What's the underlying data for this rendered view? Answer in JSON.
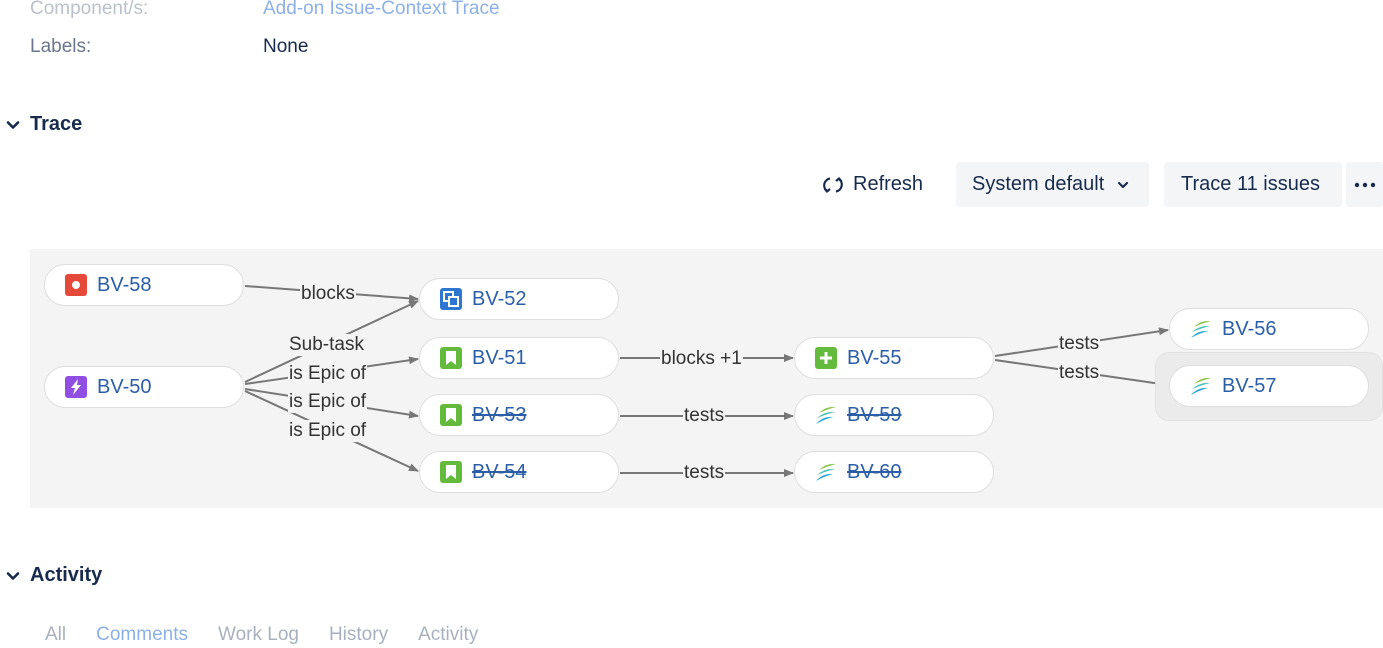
{
  "fields": {
    "component_label": "Component/s:",
    "component_value": "Add-on Issue-Context Trace",
    "labels_label": "Labels:",
    "labels_value": "None"
  },
  "trace": {
    "title": "Trace",
    "refresh_label": "Refresh",
    "layout_select": "System default",
    "trace_button": "Trace 11 issues",
    "more_icon": "ellipsis-icon",
    "nodes": [
      {
        "key": "BV-58",
        "type": "bug",
        "done": false
      },
      {
        "key": "BV-50",
        "type": "epic",
        "done": false
      },
      {
        "key": "BV-52",
        "type": "subtask",
        "done": false
      },
      {
        "key": "BV-51",
        "type": "story",
        "done": false
      },
      {
        "key": "BV-53",
        "type": "story",
        "done": true
      },
      {
        "key": "BV-54",
        "type": "story",
        "done": true
      },
      {
        "key": "BV-55",
        "type": "new-feature",
        "done": false
      },
      {
        "key": "BV-59",
        "type": "test",
        "done": true
      },
      {
        "key": "BV-60",
        "type": "test",
        "done": true
      },
      {
        "key": "BV-56",
        "type": "test",
        "done": false
      },
      {
        "key": "BV-57",
        "type": "test",
        "done": false
      }
    ],
    "edges": [
      {
        "label": "blocks"
      },
      {
        "label": "Sub-task"
      },
      {
        "label": "is Epic of"
      },
      {
        "label": "is Epic of"
      },
      {
        "label": "is Epic of"
      },
      {
        "label": "blocks +1"
      },
      {
        "label": "tests"
      },
      {
        "label": "tests"
      },
      {
        "label": "tests"
      },
      {
        "label": "tests"
      }
    ],
    "colors": {
      "bug": "#e5493a",
      "epic": "#904ee2",
      "subtask": "#4bade8",
      "story": "#63ba3c",
      "new-feature": "#63ba3c",
      "test": "#4bc0b5",
      "link": "#2b5ea7",
      "edge": "#777777"
    }
  },
  "activity": {
    "title": "Activity",
    "tabs": [
      "All",
      "Comments",
      "Work Log",
      "History",
      "Activity"
    ],
    "active_tab": "Comments"
  }
}
